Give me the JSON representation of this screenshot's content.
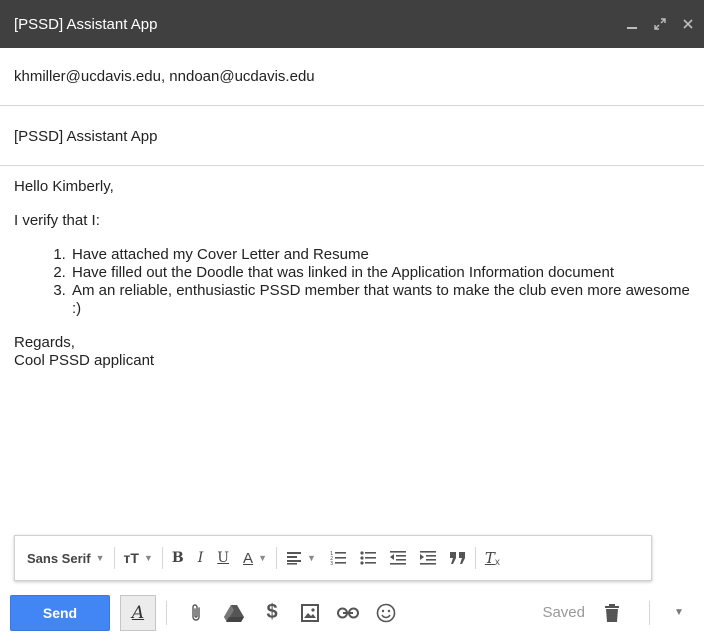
{
  "window": {
    "title": "[PSSD] Assistant App",
    "minimize_icon": "minimize-icon",
    "popout_icon": "popout-icon",
    "close_icon": "close-icon"
  },
  "compose": {
    "to": "khmiller@ucdavis.edu, nndoan@ucdavis.edu",
    "subject": "[PSSD] Assistant App"
  },
  "body": {
    "greeting": "Hello Kimberly,",
    "intro": "I verify that I:",
    "list": [
      "Have attached my Cover Letter and Resume",
      "Have filled out the Doodle that was linked in the Application Information document",
      "Am an reliable, enthusiastic PSSD member that wants to make the club even more awesome :)"
    ],
    "signoff": "Regards,",
    "signature": "Cool PSSD applicant"
  },
  "formatting": {
    "font": "Sans Serif",
    "size_glyph": "тT",
    "bold": "B",
    "italic": "I",
    "underline": "U",
    "text_color": "A",
    "remove_format": "T"
  },
  "actions": {
    "send_label": "Send",
    "format_toggle": "A",
    "saved_label": "Saved"
  },
  "colors": {
    "titlebar": "#404040",
    "send_button": "#4285f4"
  }
}
